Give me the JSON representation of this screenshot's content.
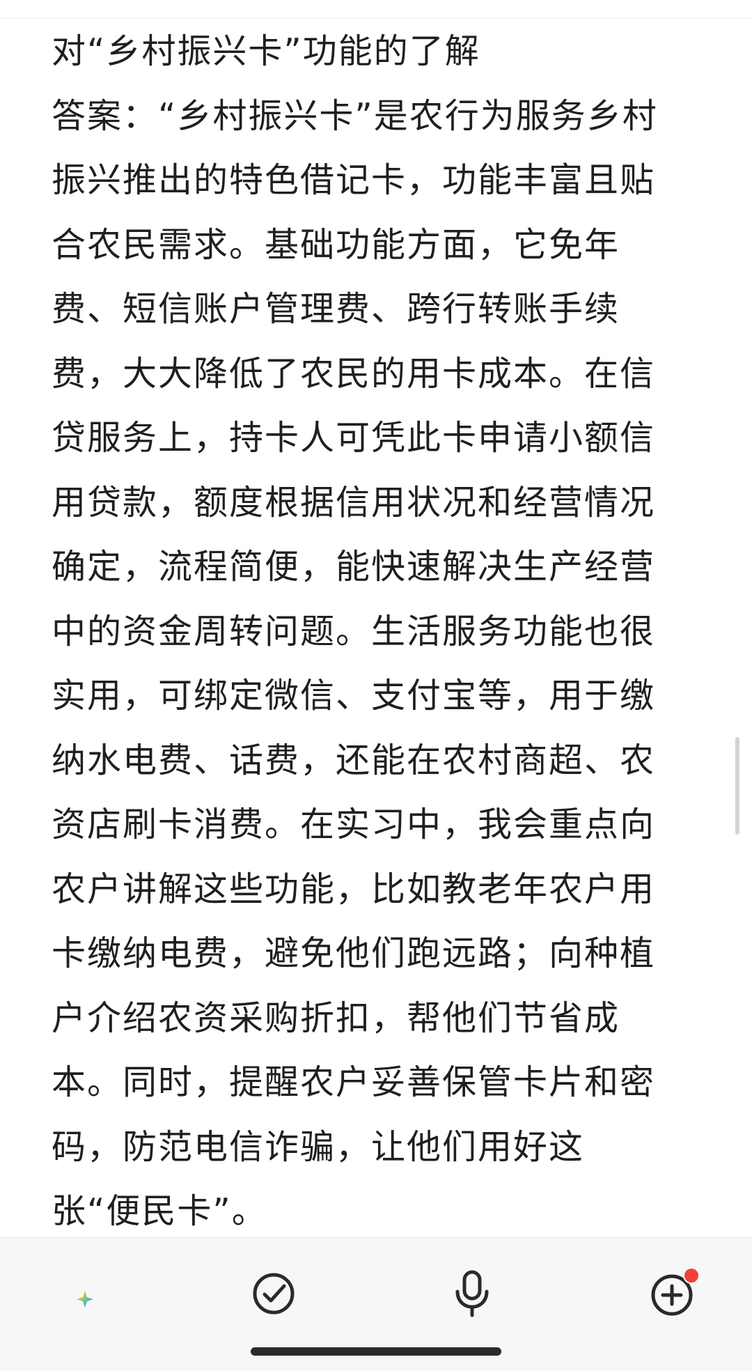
{
  "note": {
    "lines": [
      "对“乡村振兴卡”功能的了解",
      "答案：“乡村振兴卡”是农行为服务乡村",
      "振兴推出的特色借记卡，功能丰富且贴",
      "合农民需求。基础功能方面，它免年",
      "费、短信账户管理费、跨行转账手续",
      "费，大大降低了农民的用卡成本。在信",
      "贷服务上，持卡人可凭此卡申请小额信",
      "用贷款，额度根据信用状况和经营情况",
      "确定，流程简便，能快速解决生产经营",
      "中的资金周转问题。生活服务功能也很",
      "实用，可绑定微信、支付宝等，用于缴",
      "纳水电费、话费，还能在农村商超、农",
      "资店刷卡消费。在实习中，我会重点向",
      "农户讲解这些功能，比如教老年农户用",
      "卡缴纳电费，避免他们跑远路；向种植",
      "户介绍农资采购折扣，帮他们节省成",
      "本。同时，提醒农户妥善保管卡片和密",
      "码，防范电信诈骗，让他们用好这",
      "张“便民卡”。"
    ]
  },
  "toolbar": {
    "items": [
      {
        "name": "format-icon",
        "label": "format"
      },
      {
        "name": "checklist-icon",
        "label": "checklist"
      },
      {
        "name": "microphone-icon",
        "label": "voice"
      },
      {
        "name": "add-circle-icon",
        "label": "add"
      }
    ]
  },
  "colors": {
    "text": "#1f1f1f",
    "icon": "#2a2a2a",
    "badge": "#f0443a",
    "toolbar_bg": "#f7f7f7",
    "gradient": [
      "#f26a8d",
      "#f6b73c",
      "#5ec9a0",
      "#5b8def",
      "#9b6cf0"
    ]
  }
}
